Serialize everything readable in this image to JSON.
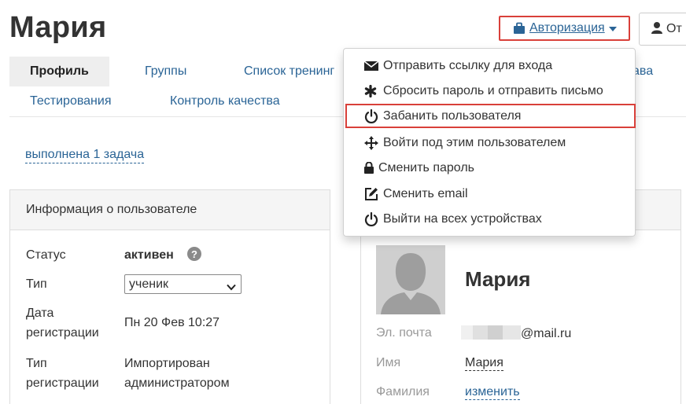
{
  "header": {
    "title": "Мария",
    "auth_button_label": "Авторизация",
    "other_button_label": "От"
  },
  "tabs": [
    {
      "label": "Профиль",
      "active": true
    },
    {
      "label": "Группы",
      "active": false
    },
    {
      "label": "Список тренинг",
      "active": false
    },
    {
      "label": "ава",
      "active": false
    },
    {
      "label": "Тестирования",
      "active": false
    },
    {
      "label": "Контроль качества",
      "active": false
    }
  ],
  "tasks_link": "выполнена 1 задача",
  "auth_menu": {
    "items": [
      {
        "label": "Отправить ссылку для входа",
        "icon": "envelope-icon"
      },
      {
        "label": "Сбросить пароль и отправить письмо",
        "icon": "asterisk-icon"
      },
      {
        "label": "Забанить пользователя",
        "icon": "power-icon",
        "highlighted": true
      },
      {
        "label": "Войти под этим пользователем",
        "icon": "move-icon"
      },
      {
        "label": "Сменить пароль",
        "icon": "lock-icon"
      },
      {
        "label": "Сменить email",
        "icon": "edit-icon"
      },
      {
        "label": "Выйти на всех устройствах",
        "icon": "power-icon"
      }
    ]
  },
  "user_info": {
    "heading": "Информация о пользователе",
    "status_label": "Статус",
    "status_value": "активен",
    "type_label": "Тип",
    "type_value": "ученик",
    "reg_date_label_1": "Дата",
    "reg_date_label_2": "регистрации",
    "reg_date_value": "Пн 20 Фев 10:27",
    "reg_type_label_1": "Тип",
    "reg_type_label_2": "регистрации",
    "reg_type_value_1": "Импортирован",
    "reg_type_value_2": "администратором"
  },
  "profile": {
    "name": "Мария",
    "email_label": "Эл. почта",
    "email_suffix": "@mail.ru",
    "first_name_label": "Имя",
    "first_name_value": "Мария",
    "last_name_label": "Фамилия",
    "last_name_action": "изменить"
  },
  "colors": {
    "link": "#2a6496",
    "highlight_border": "#d9403a",
    "panel_heading_bg": "#f5f5f5",
    "active_tab_bg": "#eeeeee"
  }
}
